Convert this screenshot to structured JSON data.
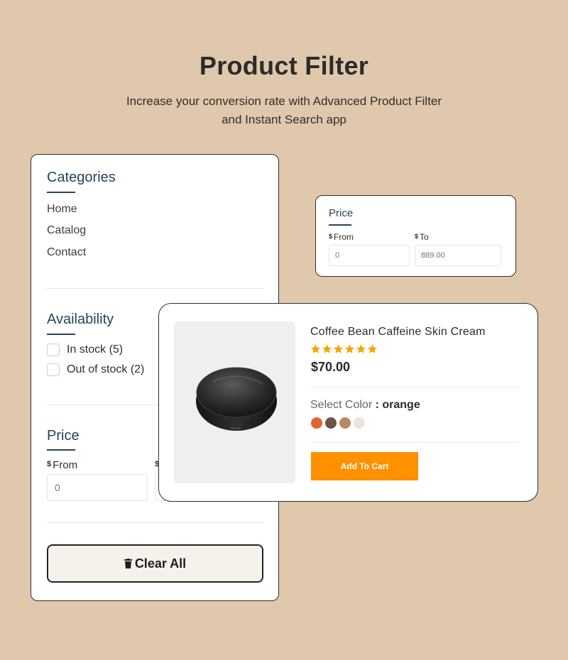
{
  "hero": {
    "title": "Product Filter",
    "subtitle_line1": "Increase your conversion rate with Advanced Product Filter",
    "subtitle_line2": "and Instant Search app"
  },
  "filter_panel": {
    "categories": {
      "title": "Categories",
      "items": [
        "Home",
        "Catalog",
        "Contact"
      ]
    },
    "availability": {
      "title": "Availability",
      "options": [
        {
          "label": "In stock (5)",
          "checked": false
        },
        {
          "label": "Out of stock (2)",
          "checked": false
        }
      ]
    },
    "price": {
      "title": "Price",
      "currency": "$",
      "from_label": "From",
      "from_placeholder": "0"
    },
    "clear_label": "Clear All"
  },
  "price_widget": {
    "title": "Price",
    "currency": "$",
    "from_label": "From",
    "to_label": "To",
    "from_placeholder": "0",
    "to_placeholder": "889.00"
  },
  "product": {
    "name": "Coffee Bean Caffeine Skin Cream",
    "rating": 5,
    "price": "$70.00",
    "select_color_label": "Select Color",
    "selected_color": ": orange",
    "swatches": [
      {
        "name": "orange",
        "color": "#e0652f"
      },
      {
        "name": "dark-brown",
        "color": "#6e5348"
      },
      {
        "name": "tan",
        "color": "#b88a60"
      },
      {
        "name": "cream",
        "color": "#eee3da"
      }
    ],
    "add_to_cart": "Add To Cart"
  },
  "colors": {
    "background": "#e0c8ac",
    "heading_blue": "#264653",
    "accent_orange": "#ff9000",
    "star": "#f7a400"
  }
}
